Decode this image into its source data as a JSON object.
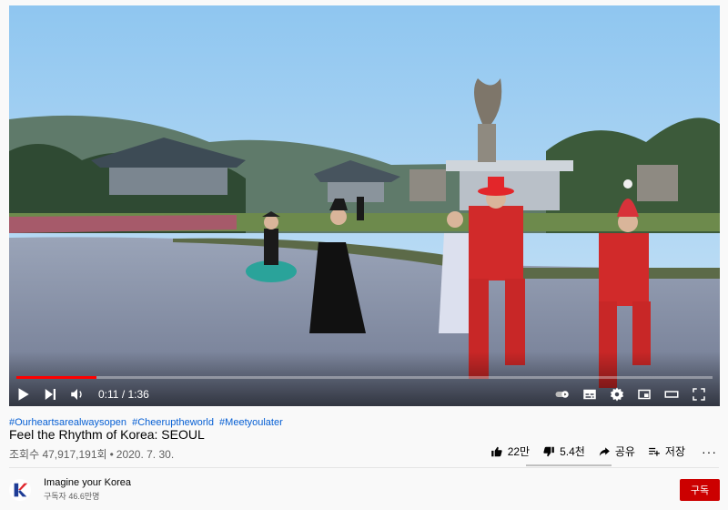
{
  "player": {
    "time_current": "0:11",
    "time_total": "1:36",
    "progress_fraction": 0.115
  },
  "colors": {
    "progress": "#ff0000",
    "subscribe": "#cc0000",
    "link": "#065fd4",
    "channel_logo_blue": "#1e3c96",
    "channel_logo_red": "#e0282e"
  },
  "video": {
    "hashtags": [
      "#Ourheartsarealwaysopen",
      "#Cheeruptheworld",
      "#Meetyoulater"
    ],
    "title": "Feel the Rhythm of Korea: SEOUL",
    "views": "조회수 47,917,191회",
    "date": "2020. 7. 30."
  },
  "actions": {
    "like": "22만",
    "dislike": "5.4천",
    "share": "공유",
    "save": "저장",
    "more": "···"
  },
  "channel": {
    "name": "Imagine your Korea",
    "subscribers": "구독자 46.6만명",
    "subscribe_label": "구독"
  },
  "icons": {
    "play": "play-icon",
    "next": "next-icon",
    "volume": "volume-icon",
    "autoplay": "autoplay-toggle-icon",
    "subtitles": "subtitles-icon",
    "settings": "gear-icon",
    "miniplayer": "miniplayer-icon",
    "theater": "theater-icon",
    "fullscreen": "fullscreen-icon",
    "like": "thumbs-up-icon",
    "dislike": "thumbs-down-icon",
    "share": "share-icon",
    "save": "save-playlist-icon"
  }
}
